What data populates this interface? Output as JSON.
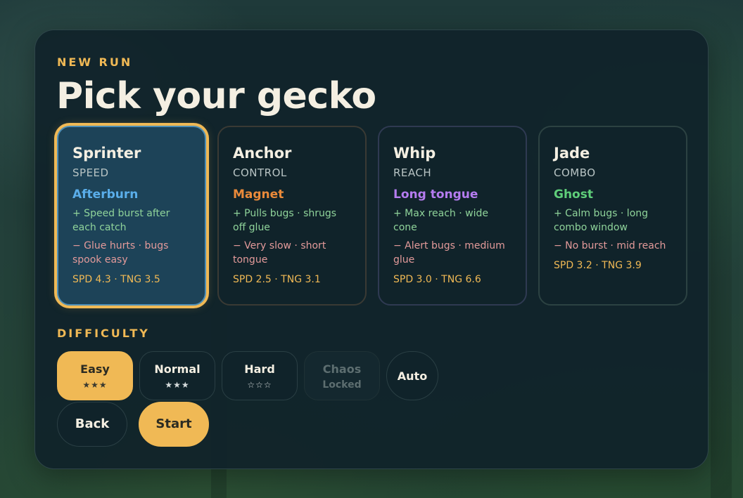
{
  "header": {
    "eyebrow": "NEW RUN",
    "title": "Pick your gecko"
  },
  "selected_gecko": "Sprinter",
  "geckos": [
    {
      "name": "Sprinter",
      "role": "SPEED",
      "ability": "Afterburn",
      "ability_color": "#5aaeea",
      "pro": "+ Speed burst after each catch",
      "con": "− Glue hurts · bugs spook easy",
      "stats": "SPD 4.3 · TNG 3.5"
    },
    {
      "name": "Anchor",
      "role": "CONTROL",
      "ability": "Magnet",
      "ability_color": "#ea8a3a",
      "pro": "+ Pulls bugs · shrugs off glue",
      "con": "− Very slow · short tongue",
      "stats": "SPD 2.5 · TNG 3.1"
    },
    {
      "name": "Whip",
      "role": "REACH",
      "ability": "Long tongue",
      "ability_color": "#b57cf0",
      "pro": "+ Max reach · wide cone",
      "con": "− Alert bugs · medium glue",
      "stats": "SPD 3.0 · TNG 6.6"
    },
    {
      "name": "Jade",
      "role": "COMBO",
      "ability": "Ghost",
      "ability_color": "#5fce7a",
      "pro": "+ Calm bugs · long combo window",
      "con": "− No burst · mid reach",
      "stats": "SPD 3.2 · TNG 3.9"
    }
  ],
  "difficulty": {
    "label": "DIFFICULTY",
    "selected": "Easy",
    "options": [
      {
        "label": "Easy",
        "sub": "★★★"
      },
      {
        "label": "Normal",
        "sub": "★★★"
      },
      {
        "label": "Hard",
        "sub": "☆☆☆"
      },
      {
        "label": "Chaos",
        "sub": "Locked"
      },
      {
        "label": "Auto",
        "sub": ""
      }
    ]
  },
  "actions": {
    "back_label": "Back",
    "start_label": "Start"
  },
  "colors": {
    "accent": "#f0b955",
    "pro": "#8fd39a",
    "con": "#e39a9a"
  }
}
